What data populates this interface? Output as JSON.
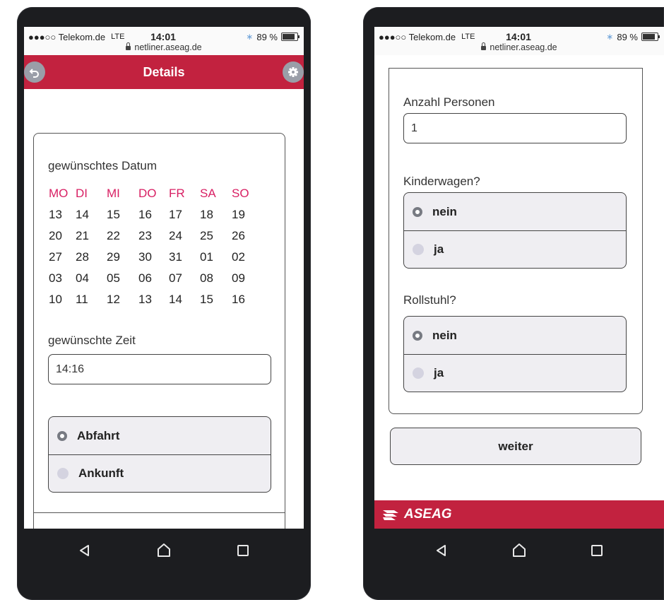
{
  "status": {
    "carrier": "●●●○○ Telekom.de",
    "network": "LTE",
    "time": "14:01",
    "bluetooth": "∗",
    "battery": "89 %",
    "url": "netliner.aseag.de"
  },
  "left": {
    "header_title": "Details",
    "date_label": "gewünschtes Datum",
    "weekdays": [
      "MO",
      "DI",
      "MI",
      "DO",
      "FR",
      "SA",
      "SO"
    ],
    "weeks": [
      [
        "13",
        "14",
        "15",
        "16",
        "17",
        "18",
        "19"
      ],
      [
        "20",
        "21",
        "22",
        "23",
        "24",
        "25",
        "26"
      ],
      [
        "27",
        "28",
        "29",
        "30",
        "31",
        "01",
        "02"
      ],
      [
        "03",
        "04",
        "05",
        "06",
        "07",
        "08",
        "09"
      ],
      [
        "10",
        "11",
        "12",
        "13",
        "14",
        "15",
        "16"
      ]
    ],
    "time_label": "gewünschte Zeit",
    "time_value": "14:16",
    "direction_options": [
      {
        "label": "Abfahrt",
        "selected": true
      },
      {
        "label": "Ankunft",
        "selected": false
      }
    ]
  },
  "right": {
    "persons_label": "Anzahl Personen",
    "persons_value": "1",
    "stroller_label": "Kinderwagen?",
    "stroller_options": [
      {
        "label": "nein",
        "selected": true
      },
      {
        "label": "ja",
        "selected": false
      }
    ],
    "wheelchair_label": "Rollstuhl?",
    "wheelchair_options": [
      {
        "label": "nein",
        "selected": true
      },
      {
        "label": "ja",
        "selected": false
      }
    ],
    "continue_label": "weiter",
    "footer_logo": "ASEAG"
  },
  "colors": {
    "brand": "#c2223f",
    "weekday": "#d81f63"
  }
}
